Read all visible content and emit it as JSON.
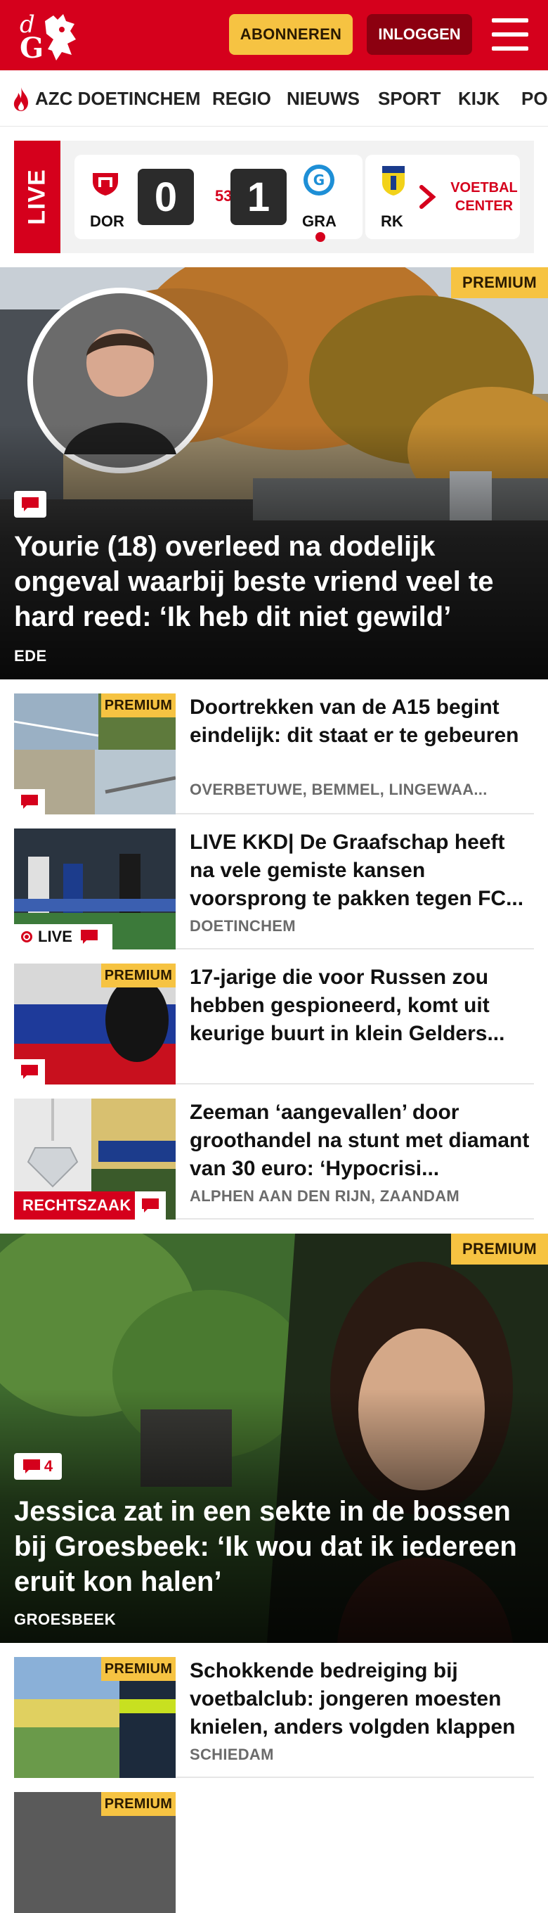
{
  "header": {
    "logo_alt": "dG",
    "subscribe_label": "ABONNEREN",
    "login_label": "INLOGGEN",
    "brand_color": "#d5001c",
    "accent_color": "#f6c342"
  },
  "nav": {
    "items": [
      {
        "label": "AZC DOETINCHEM",
        "icon": "flame-icon"
      },
      {
        "label": "REGIO"
      },
      {
        "label": "NIEUWS"
      },
      {
        "label": "SPORT"
      },
      {
        "label": "KIJK"
      },
      {
        "label": "PO"
      }
    ]
  },
  "scores": {
    "live_label": "LIVE",
    "match": {
      "home_abbr": "DOR",
      "away_abbr": "GRA",
      "home_score": "0",
      "away_score": "1",
      "minute": "53'"
    },
    "next_match": {
      "home_abbr": "RK"
    },
    "voetbal_center": {
      "line1": "VOETBAL",
      "line2": "CENTER"
    }
  },
  "hero1": {
    "premium_label": "PREMIUM",
    "title": "Yourie (18) overleed na dodelijk ongeval waarbij beste vriend veel te hard reed: ‘Ik heb dit niet gewild’",
    "location": "EDE",
    "comment_icon": "comment-icon"
  },
  "articles": [
    {
      "premium_label": "PREMIUM",
      "title": "Doortrekken van de A15 begint eindelijk: dit staat er te gebeuren",
      "location": "OVERBETUWE, BEMMEL, LINGEWAA..."
    },
    {
      "live_label": "LIVE",
      "title": "LIVE KKD| De Graafschap heeft na vele gemiste kansen voorsprong te pakken tegen FC...",
      "location": "DOETINCHEM"
    },
    {
      "premium_label": "PREMIUM",
      "title": "17-jarige die voor Russen zou hebben gespioneerd, komt uit keurige buurt in klein Gelders...",
      "location": ""
    },
    {
      "tag_label": "RECHTSZAAK",
      "title": "Zeeman ‘aangevallen’ door groothandel na stunt met diamant van 30 euro: ‘Hypocrisi...",
      "location": "ALPHEN AAN DEN RIJN, ZAANDAM"
    }
  ],
  "hero2": {
    "premium_label": "PREMIUM",
    "comment_count": "4",
    "title": "Jessica zat in een sekte in de bossen bij Groesbeek: ‘Ik wou dat ik iedereen eruit kon halen’",
    "location": "GROESBEEK"
  },
  "articles2": [
    {
      "premium_label": "PREMIUM",
      "title": "Schokkende bedreiging bij voetbalclub: jongeren moesten knielen, anders volgden klappen",
      "location": "SCHIEDAM"
    },
    {
      "premium_label": "PREMIUM"
    }
  ]
}
